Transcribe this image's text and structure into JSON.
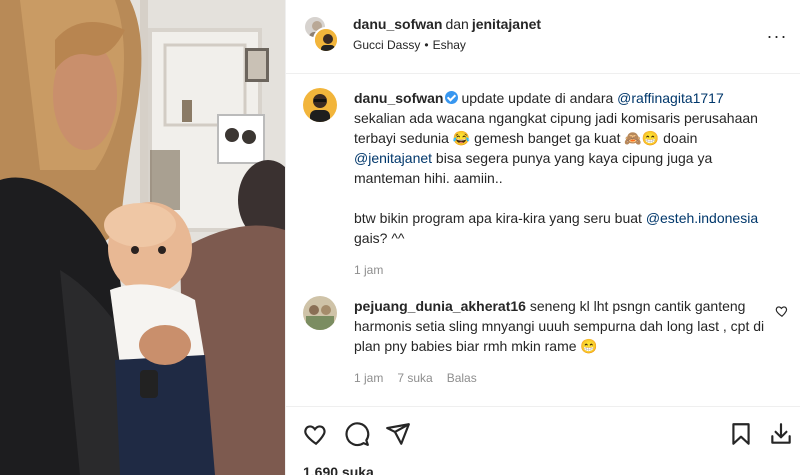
{
  "post_header": {
    "user1": "danu_sofwan",
    "joiner": "dan",
    "user2": "jenitajanet",
    "audio": "Gucci Dassy",
    "separator": "•",
    "location": "Eshay",
    "more_icon": "more-horizontal-icon",
    "more_label": "···"
  },
  "caption": {
    "username": "danu_sofwan",
    "verified": true,
    "text_1": "update update di andara ",
    "mention_1": "@raffinagita1717",
    "text_2": " sekalian ada wacana ngangkat cipung jadi komisaris perusahaan terbayi sedunia 😂 gemesh banget ga kuat 🙈😁 doain ",
    "mention_2": "@jenitajanet",
    "text_3": " bisa segera punya yang kaya cipung juga ya manteman hihi. aamiin..",
    "text_4": "btw bikin program apa kira-kira yang seru buat ",
    "mention_3": "@esteh.indonesia",
    "text_5": " gais? ^^",
    "time": "1 jam"
  },
  "comment": {
    "username": "pejuang_dunia_akherat16",
    "text": " seneng kl lht psngn cantik ganteng harmonis setia sling mnyangi uuuh sempurna dah long last , cpt di plan pny babies biar rmh mkin rame 😁",
    "time": "1 jam",
    "likes": "7 suka",
    "reply": "Balas",
    "like_icon": "heart-outline-icon"
  },
  "actions": {
    "like_icon": "heart-outline-icon",
    "comment_icon": "comment-bubble-icon",
    "share_icon": "paper-plane-icon",
    "save_icon": "bookmark-icon",
    "download_icon": "download-icon",
    "likes_count": "1.690 suka"
  },
  "colors": {
    "text": "#262626",
    "link": "#00376b",
    "muted": "#8e8e8e",
    "verified": "#3897f0",
    "border": "#efefef"
  }
}
